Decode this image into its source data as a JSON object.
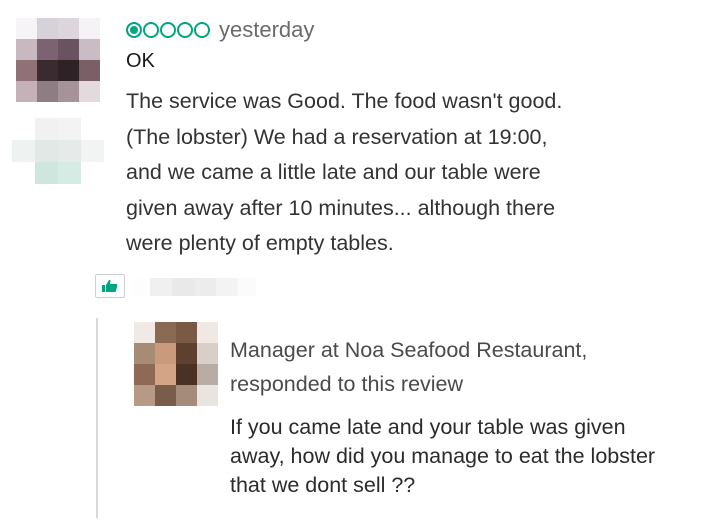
{
  "review": {
    "rating": 1,
    "rating_max": 5,
    "rating_color": "#00a680",
    "date": "yesterday",
    "title": "OK",
    "body_lines": [
      "The service was Good. The food wasn't good.",
      "(The lobster) We had a reservation at 19:00,",
      "and we came a little late and our table were",
      "given away after 10 minutes... although there",
      "were plenty of empty tables."
    ]
  },
  "helpful": {
    "icon": "thumbs-up-icon"
  },
  "response": {
    "role_line": "Manager at Noa Seafood Restaurant,",
    "action_line": "responded to this review",
    "body_lines": [
      "If you came late and your table was given",
      "away, how did you manage to eat the lobster",
      "that we dont sell ??"
    ]
  }
}
